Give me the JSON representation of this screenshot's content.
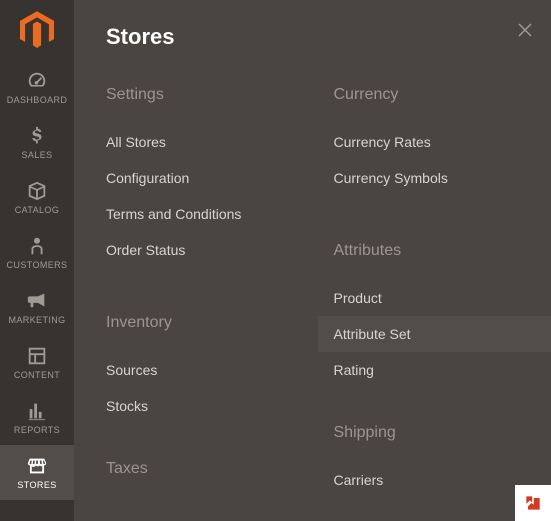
{
  "panel": {
    "title": "Stores"
  },
  "sidebar": {
    "items": [
      {
        "label": "DASHBOARD"
      },
      {
        "label": "SALES"
      },
      {
        "label": "CATALOG"
      },
      {
        "label": "CUSTOMERS"
      },
      {
        "label": "MARKETING"
      },
      {
        "label": "CONTENT"
      },
      {
        "label": "REPORTS"
      },
      {
        "label": "STORES"
      }
    ]
  },
  "groups_left": [
    {
      "head": "Settings",
      "links": [
        "All Stores",
        "Configuration",
        "Terms and Conditions",
        "Order Status"
      ]
    },
    {
      "head": "Inventory",
      "links": [
        "Sources",
        "Stocks"
      ]
    },
    {
      "head": "Taxes",
      "links": []
    }
  ],
  "groups_right": [
    {
      "head": "Currency",
      "links": [
        "Currency Rates",
        "Currency Symbols"
      ]
    },
    {
      "head": "Attributes",
      "links": [
        "Product",
        "Attribute Set",
        "Rating"
      ]
    },
    {
      "head": "Shipping",
      "links": [
        "Carriers"
      ]
    }
  ]
}
